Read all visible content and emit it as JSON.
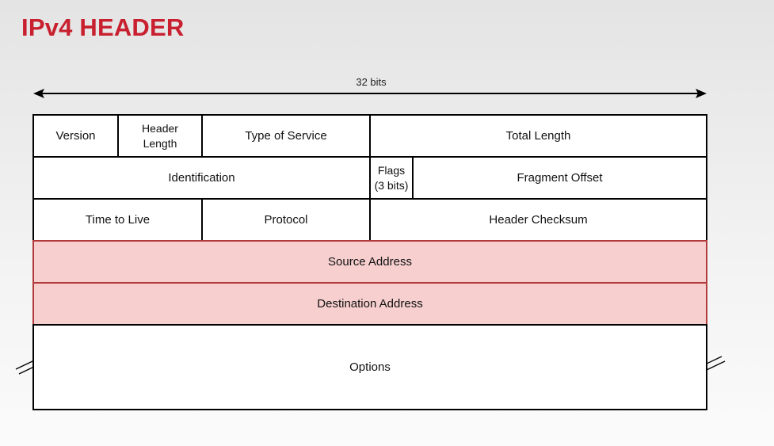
{
  "title": "IPv4 HEADER",
  "width_label": "32 bits",
  "fields": {
    "version": "Version",
    "header_length_1": "Header",
    "header_length_2": "Length",
    "type_of_service": "Type of Service",
    "total_length": "Total Length",
    "identification": "Identification",
    "flags_1": "Flags",
    "flags_2": "(3 bits)",
    "fragment_offset": "Fragment Offset",
    "time_to_live": "Time to Live",
    "protocol": "Protocol",
    "header_checksum": "Header Checksum",
    "source_address": "Source Address",
    "destination_address": "Destination Address",
    "options": "Options"
  },
  "colors": {
    "title": "#c8202f",
    "address_fill": "#f7cfcf",
    "address_border": "#b33a3a"
  }
}
